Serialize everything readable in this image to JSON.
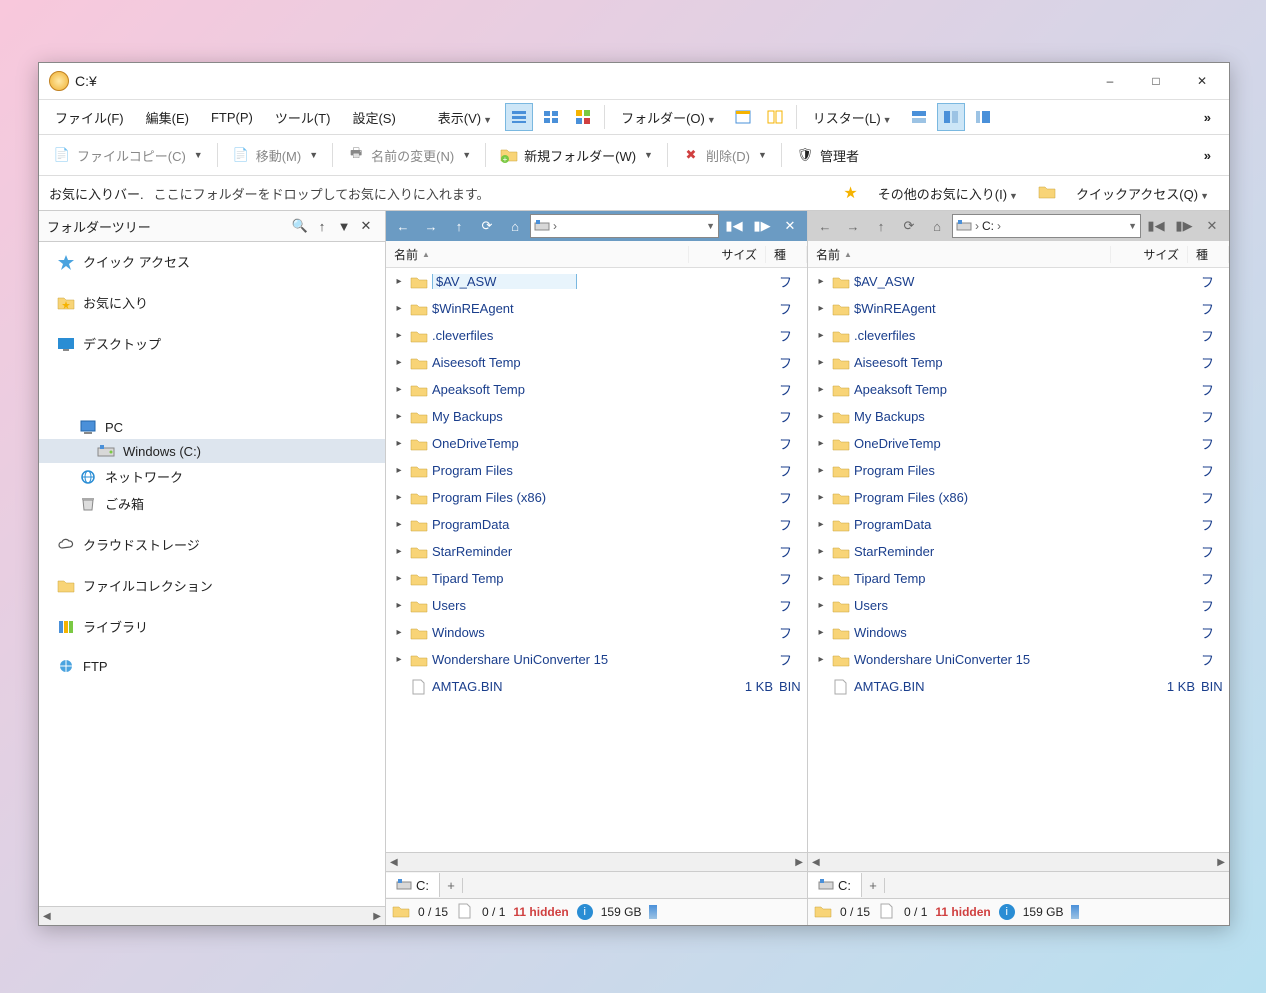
{
  "title": "C:¥",
  "menu": {
    "file": "ファイル(F)",
    "edit": "編集(E)",
    "ftp": "FTP(P)",
    "tools": "ツール(T)",
    "settings": "設定(S)",
    "view": "表示(V)",
    "folder": "フォルダー(O)",
    "lister": "リスター(L)"
  },
  "tb": {
    "copy": "ファイルコピー(C)",
    "move": "移動(M)",
    "rename": "名前の変更(N)",
    "newfolder": "新規フォルダー(W)",
    "delete": "削除(D)",
    "admin": "管理者"
  },
  "fav": {
    "label": "お気に入りバー.",
    "hint": "ここにフォルダーをドロップしてお気に入りに入れます。",
    "other": "その他のお気に入り(I)",
    "quick": "クイックアクセス(Q)"
  },
  "treehdr": {
    "label": "フォルダーツリー"
  },
  "tree": [
    {
      "label": "クイック アクセス",
      "icon": "star",
      "lvl": 1
    },
    {
      "label": "お気に入り",
      "icon": "fav",
      "lvl": 1,
      "gap": true
    },
    {
      "label": "デスクトップ",
      "icon": "desktop",
      "lvl": 1,
      "gap": true
    },
    {
      "label": "PC",
      "icon": "pc",
      "lvl": 2,
      "biggap": true
    },
    {
      "label": "Windows (C:)",
      "icon": "drive",
      "lvl": 3,
      "sel": true
    },
    {
      "label": "ネットワーク",
      "icon": "net",
      "lvl": 2
    },
    {
      "label": "ごみ箱",
      "icon": "trash",
      "lvl": 2
    },
    {
      "label": "クラウドストレージ",
      "icon": "cloud",
      "lvl": 1,
      "gap": true
    },
    {
      "label": "ファイルコレクション",
      "icon": "coll",
      "lvl": 1,
      "gap": true
    },
    {
      "label": "ライブラリ",
      "icon": "lib",
      "lvl": 1,
      "gap": true
    },
    {
      "label": "FTP",
      "icon": "ftp",
      "lvl": 1,
      "gap": true
    }
  ],
  "cols": {
    "name": "名前",
    "size": "サイズ",
    "type": "種"
  },
  "path_right": "C:",
  "files": [
    {
      "name": "$AV_ASW",
      "t": "フ",
      "folder": true,
      "sel": true
    },
    {
      "name": "$WinREAgent",
      "t": "フ",
      "folder": true
    },
    {
      "name": ".cleverfiles",
      "t": "フ",
      "folder": true
    },
    {
      "name": "Aiseesoft Temp",
      "t": "フ",
      "folder": true
    },
    {
      "name": "Apeaksoft Temp",
      "t": "フ",
      "folder": true
    },
    {
      "name": "My Backups",
      "t": "フ",
      "folder": true
    },
    {
      "name": "OneDriveTemp",
      "t": "フ",
      "folder": true
    },
    {
      "name": "Program Files",
      "t": "フ",
      "folder": true
    },
    {
      "name": "Program Files (x86)",
      "t": "フ",
      "folder": true
    },
    {
      "name": "ProgramData",
      "t": "フ",
      "folder": true
    },
    {
      "name": "StarReminder",
      "t": "フ",
      "folder": true
    },
    {
      "name": "Tipard Temp",
      "t": "フ",
      "folder": true
    },
    {
      "name": "Users",
      "t": "フ",
      "folder": true
    },
    {
      "name": "Windows",
      "t": "フ",
      "folder": true
    },
    {
      "name": "Wondershare UniConverter 15",
      "t": "フ",
      "folder": true
    },
    {
      "name": "AMTAG.BIN",
      "size": "1 KB",
      "t": "BIN",
      "folder": false
    }
  ],
  "tab": {
    "label": "C:"
  },
  "status": {
    "folders": "0 / 15",
    "files": "0 / 1",
    "hidden": "11 hidden",
    "free": "159 GB"
  }
}
